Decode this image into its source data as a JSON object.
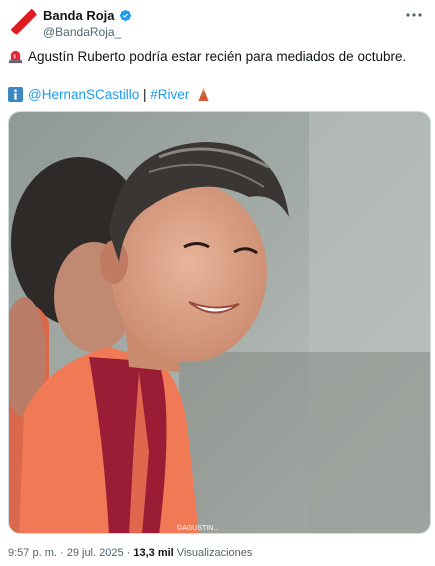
{
  "account": {
    "display_name": "Banda Roja",
    "handle": "@BandaRoja_",
    "verified": true
  },
  "post": {
    "line1_text": "Agustín Ruberto podría estar recién para mediados de octubre.",
    "line1_icon": "siren-icon",
    "line2_icon": "info-icon",
    "mention": "@HernanSCastillo",
    "separator": " | ",
    "hashtag": "#River",
    "line2_trailing_icon": "volcano-icon",
    "photo_watermark": "©AGUSTIN..."
  },
  "meta": {
    "time": "9:57 p. m.",
    "dot": " · ",
    "date": "29 jul. 2025",
    "dot2": " · ",
    "views_count": "13,3 mil",
    "views_label": " Visualizaciones"
  },
  "colors": {
    "accent": "#1d9bf0",
    "brand": "#e01b22",
    "text": "#0f1419",
    "muted": "#536471"
  }
}
